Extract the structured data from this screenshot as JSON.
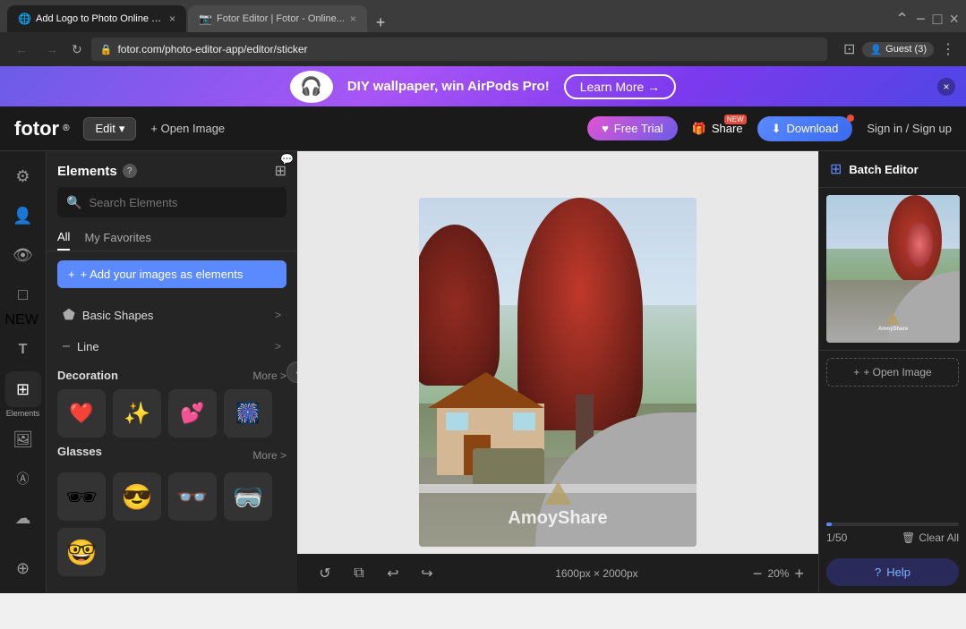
{
  "browser": {
    "tabs": [
      {
        "id": "tab1",
        "label": "Add Logo to Photo Online for...",
        "favicon": "🌐",
        "active": true
      },
      {
        "id": "tab2",
        "label": "Fotor Editor | Fotor - Online...",
        "favicon": "📷",
        "active": false
      }
    ],
    "new_tab_label": "+",
    "url": "fotor.com/photo-editor-app/editor/sticker",
    "url_lock": "🔒",
    "guest_label": "Guest (3)",
    "window_controls": {
      "minimize": "−",
      "maximize": "□",
      "close": "×"
    }
  },
  "banner": {
    "text": "DIY wallpaper, win AirPods Pro!",
    "button_label": "Learn More →",
    "close": "×"
  },
  "header": {
    "logo": "fotor",
    "logo_sup": "®",
    "edit_label": "Edit",
    "open_image_label": "+ Open Image",
    "free_trial_label": "Free Trial",
    "free_trial_icon": "♥",
    "share_label": "Share",
    "share_badge": "NEW",
    "download_label": "Download",
    "download_icon": "⬇",
    "signin_label": "Sign in / Sign up"
  },
  "icon_sidebar": {
    "items": [
      {
        "icon": "⚙",
        "name": "settings-icon"
      },
      {
        "icon": "👤",
        "name": "account-icon"
      },
      {
        "icon": "👁",
        "name": "preview-icon"
      },
      {
        "icon": "□",
        "name": "layers-icon",
        "badge": "NEW"
      },
      {
        "icon": "T",
        "name": "text-icon"
      },
      {
        "icon": "⊞",
        "name": "elements-icon",
        "label": "Elements",
        "active": true
      },
      {
        "icon": "🖼",
        "name": "frames-icon"
      },
      {
        "icon": "Ⓐ",
        "name": "effects-icon"
      },
      {
        "icon": "☁",
        "name": "cloud-icon"
      },
      {
        "icon": "⊕",
        "name": "more-icon"
      }
    ]
  },
  "left_panel": {
    "title": "Elements",
    "help_icon": "?",
    "grid_icon": "⊞",
    "search_placeholder": "Search Elements",
    "tabs": [
      {
        "label": "All",
        "active": true
      },
      {
        "label": "My Favorites",
        "active": false
      }
    ],
    "add_button_label": "+ Add your images as elements",
    "categories": [
      {
        "icon": "⬟",
        "label": "Basic Shapes",
        "arrow": ">"
      },
      {
        "icon": "⎯",
        "label": "Line",
        "arrow": ">"
      }
    ],
    "decoration": {
      "title": "Decoration",
      "more_label": "More >",
      "items": [
        {
          "emoji": "❤️",
          "name": "heart-sticker"
        },
        {
          "emoji": "✨",
          "name": "sparkle-sticker"
        },
        {
          "emoji": "💕",
          "name": "hearts-sticker"
        },
        {
          "emoji": "🎆",
          "name": "firework-sticker"
        }
      ]
    },
    "glasses": {
      "title": "Glasses",
      "more_label": "More >",
      "items": [
        {
          "emoji": "🕶",
          "name": "sunglasses1"
        },
        {
          "emoji": "😎",
          "name": "sunglasses2"
        },
        {
          "emoji": "👓",
          "name": "glasses1"
        },
        {
          "emoji": "🥽",
          "name": "goggles"
        },
        {
          "emoji": "🤓",
          "name": "nerd-glasses"
        }
      ]
    }
  },
  "canvas": {
    "dims_label": "1600px × 2000px",
    "zoom_label": "20%",
    "watermark_name": "AmoyShare",
    "tools": {
      "rotate": "↺",
      "duplicate": "⧉",
      "undo": "↩",
      "redo": "↪"
    },
    "zoom_minus": "−",
    "zoom_plus": "+"
  },
  "right_panel": {
    "batch_editor_label": "Batch Editor",
    "batch_icon": "⊞",
    "open_image_label": "+ Open Image",
    "progress": {
      "current": 1,
      "total": 50
    },
    "page_count": "1/50",
    "clear_all_label": "Clear All",
    "help_label": "Help",
    "help_icon": "?"
  }
}
